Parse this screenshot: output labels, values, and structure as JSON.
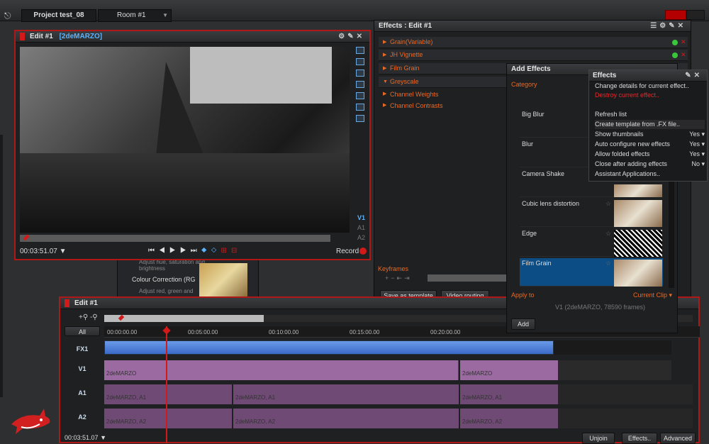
{
  "topbar": {
    "project_tab": "Project test_08",
    "room_tab": "Room #1",
    "room_arrow": "▼"
  },
  "viewer": {
    "title": "Edit #1",
    "clip_name": "[2deMARZO]",
    "track_labels": [
      "V1",
      "A1",
      "A2"
    ],
    "timecode": "00:03:51.07",
    "timecode_arrow": "▼",
    "record_label": "Record"
  },
  "effects": {
    "title": "Effects : Edit #1",
    "rows": [
      "Grain(Variable)",
      "JH Vignette",
      "Film Grain",
      "Greyscale"
    ],
    "sub_rows": [
      "Channel Weights",
      "Channel Contrasts"
    ],
    "keyframes_label": "Keyframes",
    "save_template_button": "Save as template",
    "video_routing_button": "Video routing"
  },
  "bin": {
    "item1_desc": "Adjust hue, saturation and brightness",
    "item2_name": "Colour Correction (RG",
    "item2_desc": "Adjust red, green and"
  },
  "add_effects": {
    "title": "Add Effects",
    "category_label": "Category",
    "categories": [
      "Big Blur",
      "Blur",
      "Camera Shake",
      "Cubic lens distortion",
      "Edge",
      "Film Grain"
    ],
    "selected_category": "Film Grain",
    "apply_to_label": "Apply to",
    "apply_to_value": "Current Clip",
    "apply_clip_info": "V1 (2deMARZO, 78590 frames)",
    "add_button": "Add"
  },
  "effects_menu": {
    "title": "Effects",
    "items": [
      {
        "label": "Change details for current effect..",
        "value": ""
      },
      {
        "label": "Destroy current effect..",
        "value": ""
      },
      {
        "label": "Refresh list",
        "value": ""
      },
      {
        "label": "Create template from .FX file..",
        "value": ""
      },
      {
        "label": "Show thumbnails",
        "value": "Yes"
      },
      {
        "label": "Auto configure new effects",
        "value": "Yes"
      },
      {
        "label": "Allow folded effects",
        "value": "Yes"
      },
      {
        "label": "Close after adding effects",
        "value": "No"
      },
      {
        "label": "Assistant Applications..",
        "value": ""
      }
    ]
  },
  "timeline": {
    "title": "Edit #1",
    "all_button": "All",
    "ruler_ticks": [
      "00:00:00.00",
      "00:05:00.00",
      "00:10:00.00",
      "00:15:00.00",
      "00:20:00.00"
    ],
    "tracks": [
      {
        "label": "FX1",
        "clips": [
          ""
        ]
      },
      {
        "label": "V1",
        "clips": [
          "2deMARZO",
          "2deMARZO"
        ]
      },
      {
        "label": "A1",
        "clips": [
          "2deMARZO, A1",
          "2deMARZO, A1",
          "2deMARZO, A1"
        ]
      },
      {
        "label": "A2",
        "clips": [
          "2deMARZO, A2",
          "2deMARZO, A2",
          "2deMARZO, A2"
        ]
      }
    ],
    "timecode": "00:03:51.07",
    "timecode_arrow": "▼",
    "unjoin_button": "Unjoin",
    "effects_button": "Effects..",
    "advanced_button": "Advanced"
  },
  "colors": {
    "accent_orange": "#e86a24",
    "record_red": "#d21a1a",
    "selection_blue": "#0d4d85",
    "fx_track_blue": "#4a7fd8",
    "clip_purple": "#9a6aa0"
  }
}
